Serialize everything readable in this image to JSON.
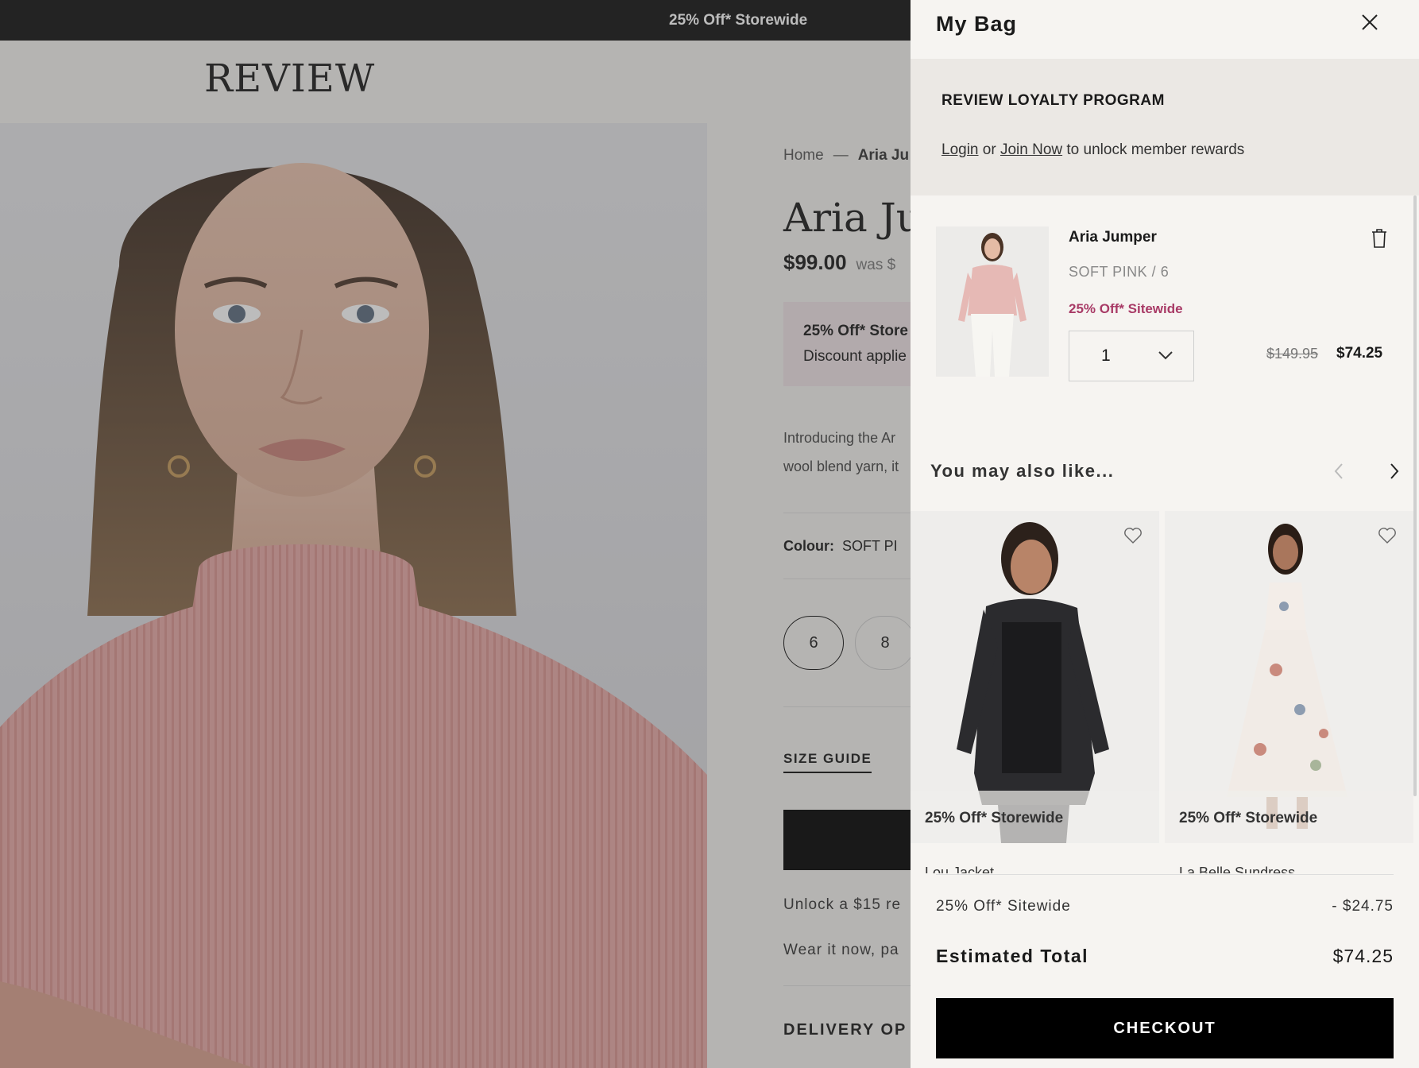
{
  "promo_bar": {
    "text": "25% Off* Storewide"
  },
  "header": {
    "logo": "REVIEW"
  },
  "product_page": {
    "breadcrumb": {
      "home": "Home",
      "separator": "—",
      "current": "Aria Ju"
    },
    "title": "Aria Jun",
    "price": "$99.00",
    "was_text": "was $",
    "promo_box": {
      "title": "25% Off* Store",
      "subtitle": "Discount applie"
    },
    "description": "Introducing the Ar\nwool blend yarn, it",
    "colour_label": "Colour:",
    "colour_value": "SOFT PI",
    "sizes": [
      "6",
      "8"
    ],
    "selected_size": "6",
    "size_guide": "SIZE GUIDE",
    "unlock_text": "Unlock a $15 re",
    "wear_text": "Wear it now, pa",
    "delivery_heading": "DELIVERY OP"
  },
  "drawer": {
    "title": "My Bag",
    "close_icon": "close-icon",
    "loyalty": {
      "title": "REVIEW LOYALTY PROGRAM",
      "login": "Login",
      "or": "or",
      "join": "Join Now",
      "suffix": "to unlock member rewards"
    },
    "item": {
      "name": "Aria Jumper",
      "variant": "SOFT PINK / 6",
      "promo": "25% Off* Sitewide",
      "quantity": "1",
      "original_price": "$149.95",
      "price": "$74.25",
      "trash_icon": "trash-icon"
    },
    "recommendations": {
      "title": "You may also like...",
      "cards": [
        {
          "badge": "25% Off* Storewide",
          "name": "Lou Jacket"
        },
        {
          "badge": "25% Off* Storewide",
          "name": "La Belle Sundress"
        }
      ]
    },
    "summary": {
      "discount_label": "25% Off* Sitewide",
      "discount_value": "- $24.75",
      "total_label": "Estimated Total",
      "total_value": "$74.25",
      "checkout": "CHECKOUT"
    }
  },
  "colors": {
    "promo_bar_bg": "#111111",
    "promo_text": "#a83a66",
    "checkout_bg": "#000000",
    "drawer_bg": "#f6f4f1",
    "loyalty_bg": "#ebe8e4"
  }
}
